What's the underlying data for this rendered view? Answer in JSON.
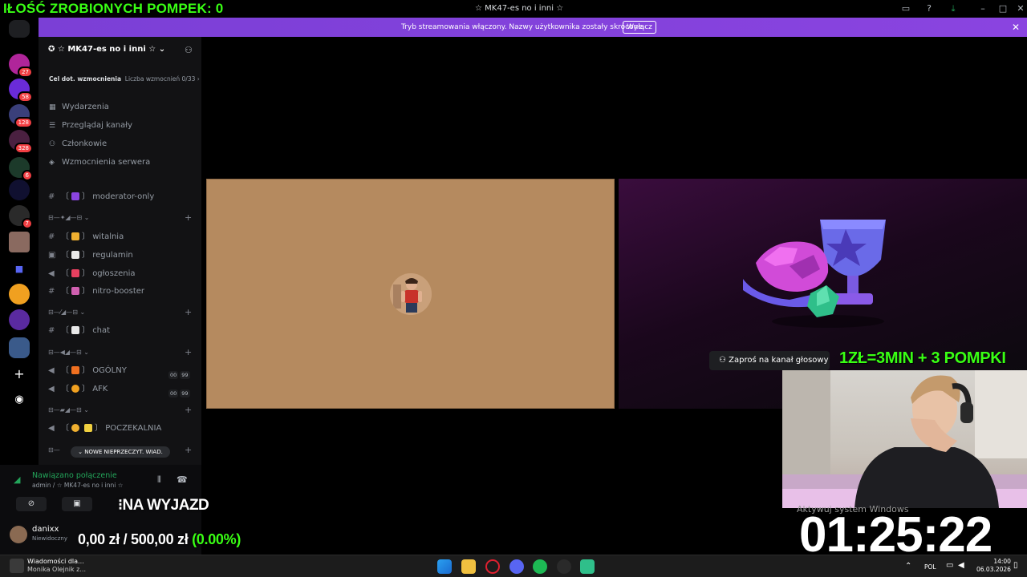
{
  "overlay": {
    "pushup_count": "IŁOŚĆ ZROBIONYCH POMPEK: 0",
    "na_wyjazd": "⁝NA WYJAZD",
    "money_current": "0,00 zł",
    "money_sep": " / ",
    "money_goal": "500,00 zł",
    "money_pct": "(0.00%)",
    "promo": "1ZŁ=3MIN + 3 POMPKI",
    "timer": "01:25:22",
    "activate_windows": "Aktywuj system Windows"
  },
  "window": {
    "title": "☆ MK47-es no i inni ☆"
  },
  "banner": {
    "text": "Tryb streamowania włączony. Nazwy użytkownika zostały skrócone.",
    "button": "Wyłącz"
  },
  "server_badges": [
    "27",
    "58",
    "128",
    "328",
    "6",
    "7"
  ],
  "guild": {
    "name": "☆ MK47-es no i inni ☆",
    "boost_goal": "Cel dot. wzmocnienia",
    "boost_count": "Liczba wzmocnień 0/33 ›"
  },
  "nav": [
    "Wydarzenia",
    "Przeglądaj kanały",
    "Członkowie",
    "Wzmocnienia serwera"
  ],
  "channels": {
    "moderator_only": "moderator-only",
    "witalnia": "witalnia",
    "regulamin": "regulamin",
    "ogloszenia": "ogłoszenia",
    "nitro_booster": "nitro-booster",
    "chat": "chat",
    "ogolny": "OGÓLNY",
    "afk": "AFK",
    "poczekalnia": "POCZEKALNIA",
    "vc_count_a": "00",
    "vc_count_b": "99"
  },
  "new_messages": "⌄ NOWE NIEPRZECZYT. WIAD.",
  "voice": {
    "connected": "Nawiązano połączenie",
    "sub": "admin / ☆ MK47-es no i inni ☆"
  },
  "user": {
    "name": "danixx",
    "status": "Niewidoczny"
  },
  "stage": {
    "invite": "Zaproś na kanał głosowy"
  },
  "taskbar": {
    "notif_title": "Wiadomości dla...",
    "notif_sub": "Monika Olejnik z...",
    "lang": "POL",
    "time": "14:00",
    "date": "06.03.2026"
  },
  "colors": {
    "accent": "#8a44e0",
    "overlay_green": "#39ff14",
    "discord_green": "#23a55a"
  }
}
